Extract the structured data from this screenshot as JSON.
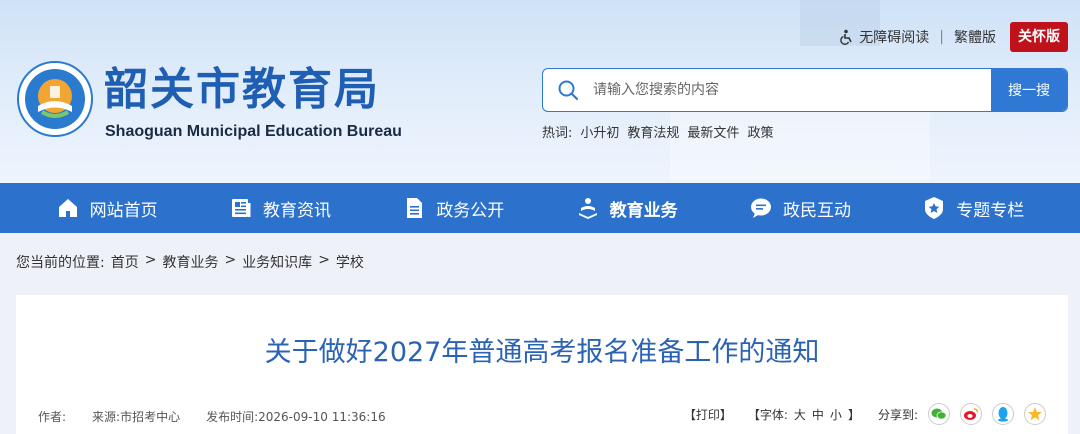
{
  "header": {
    "site_title": "韶关市教育局",
    "site_subtitle": "Shaoguan Municipal Education Bureau",
    "top_links": {
      "accessible": "无障碍阅读",
      "traditional": "繁體版",
      "care": "关怀版"
    }
  },
  "search": {
    "placeholder": "请输入您搜索的内容",
    "button": "搜一搜"
  },
  "hot": {
    "label": "热词:",
    "keywords": [
      "小升初",
      "教育法规",
      "最新文件",
      "政策"
    ]
  },
  "nav": [
    {
      "label": "网站首页",
      "icon": "home-icon"
    },
    {
      "label": "教育资讯",
      "icon": "news-icon"
    },
    {
      "label": "政务公开",
      "icon": "document-icon"
    },
    {
      "label": "教育业务",
      "icon": "education-icon"
    },
    {
      "label": "政民互动",
      "icon": "chat-icon"
    },
    {
      "label": "专题专栏",
      "icon": "badge-icon"
    }
  ],
  "breadcrumb": {
    "label": "您当前的位置:",
    "items": [
      "首页",
      "教育业务",
      "业务知识库",
      "学校"
    ],
    "separator": ">"
  },
  "article": {
    "title": "关于做好2027年普通高考报名准备工作的通知",
    "author_label": "作者:",
    "source": "来源:市招考中心",
    "publish_time": "发布时间:2026-09-10 11:36:16",
    "print": "【打印】",
    "font_size": "【字体:",
    "font_large": "大",
    "font_medium": "中",
    "font_small": "小",
    "font_close": "】",
    "share_label": "分享到:"
  },
  "colors": {
    "primary": "#2c72cc",
    "title": "#2b63b4",
    "care": "#c0121a"
  }
}
